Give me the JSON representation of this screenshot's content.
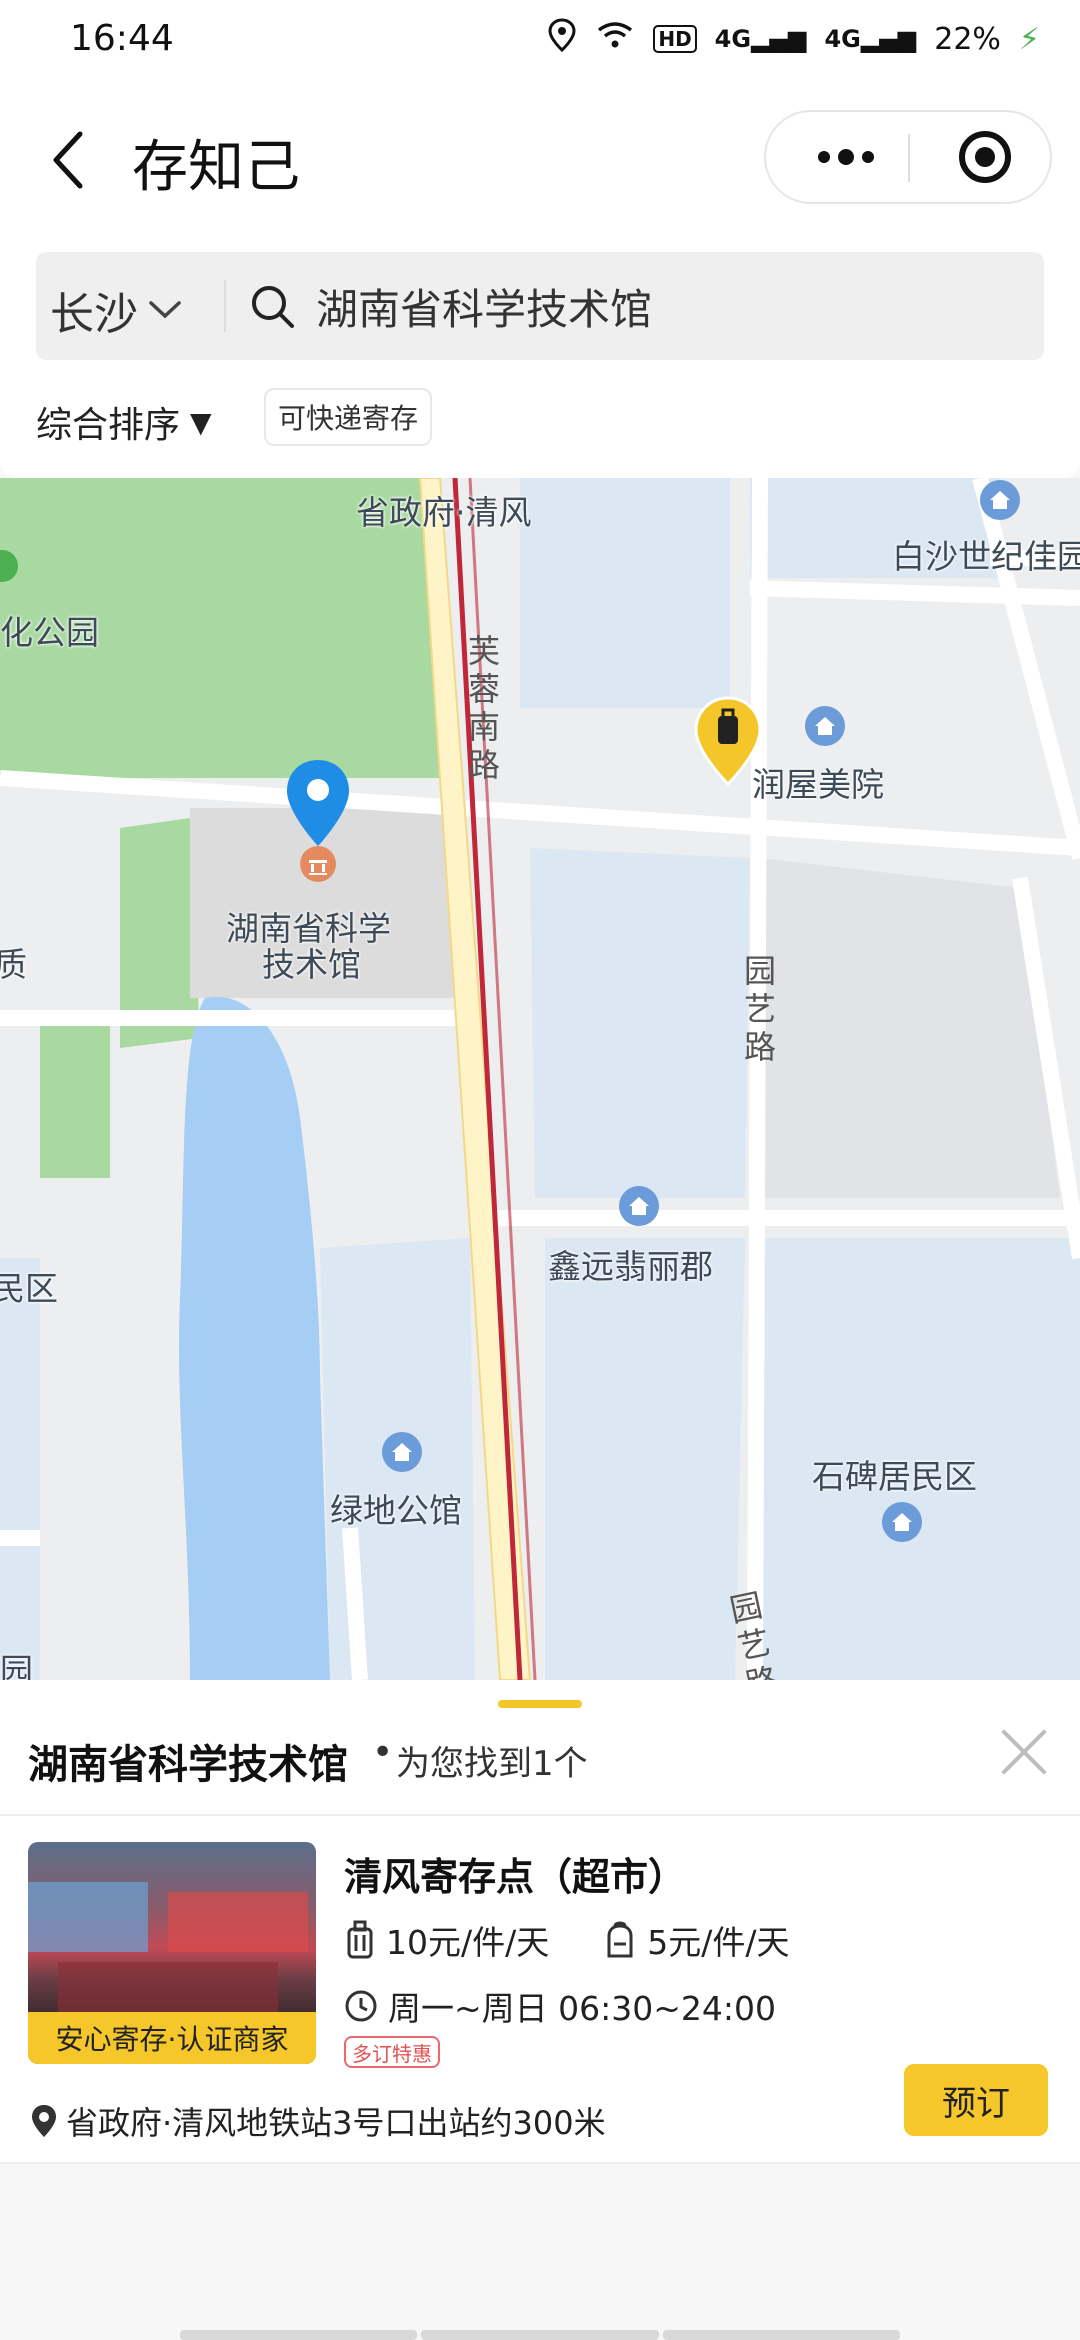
{
  "status_bar": {
    "time": "16:44",
    "signal_a": "4G",
    "signal_b": "4G",
    "hd": "HD",
    "battery": "22%",
    "icons": [
      "location-icon",
      "wifi-icon",
      "hd-icon",
      "signal-icon",
      "battery-charging-icon"
    ]
  },
  "header": {
    "title": "存知己",
    "back_icon": "chevron-left-icon",
    "more_icon": "more-dots-icon",
    "target_icon": "target-icon"
  },
  "search": {
    "city": "长沙",
    "query": "湖南省科学技术馆"
  },
  "filters": {
    "sort_label": "综合排序",
    "sort_arrow": "▼",
    "chip_label": "可快递寄存"
  },
  "map": {
    "labels": {
      "top_stop": "省政府·清风",
      "park": "化公园",
      "baisha": "白沙世纪佳园",
      "furong_road": "芙蓉南路",
      "runwu": "润屋美院",
      "kejiguan_line1": "湖南省科学",
      "kejiguan_line2": "技术馆",
      "left_fragment": "质",
      "yuanyi_road_1": "园艺路",
      "xinyuan": "鑫远翡丽郡",
      "left_area": "民区",
      "shibei": "石碑居民区",
      "lvdi": "绿地公馆",
      "yuanyi_road_2": "园艺路",
      "left_bottom": "园"
    },
    "colors": {
      "background": "#eceeef",
      "park": "#a8d9a0",
      "water": "#a6cdf3",
      "block": "#dbe7f3",
      "major_road": "#fff4c8",
      "road_line": "#c0283a",
      "pin_blue": "#1f8ce6",
      "pin_yellow": "#f4c62a"
    }
  },
  "sheet": {
    "title": "湖南省科学技术馆",
    "dot": "•",
    "subtitle": "为您找到1个",
    "close_icon": "close-icon"
  },
  "store": {
    "name": "清风寄存点（超市）",
    "badge": "安心寄存·认证商家",
    "price_large": "10元/件/天",
    "price_small": "5元/件/天",
    "hours": "周一~周日 06:30~24:00",
    "promo": "多订特惠",
    "address": "省政府·清风地铁站3号口出站约300米",
    "book_label": "预订"
  }
}
